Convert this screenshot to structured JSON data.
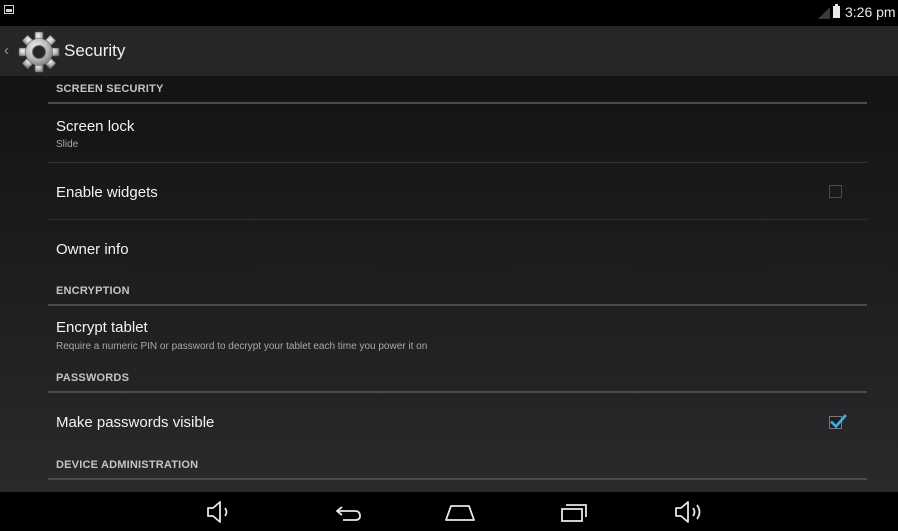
{
  "status_bar": {
    "time": "3:26 pm",
    "icons": [
      "notification-icon",
      "signal-icon",
      "battery-icon"
    ]
  },
  "action_bar": {
    "title": "Security",
    "icons": [
      "up-caret-icon",
      "settings-gear-icon"
    ]
  },
  "sections": {
    "screen_security": {
      "header": "SCREEN SECURITY",
      "screen_lock": {
        "title": "Screen lock",
        "summary": "Slide"
      },
      "enable_widgets": {
        "title": "Enable widgets",
        "checked": false
      },
      "owner_info": {
        "title": "Owner info"
      }
    },
    "encryption": {
      "header": "ENCRYPTION",
      "encrypt_tablet": {
        "title": "Encrypt tablet",
        "summary": "Require a numeric PIN or password to decrypt your tablet each time you power it on"
      }
    },
    "passwords": {
      "header": "PASSWORDS",
      "make_passwords_visible": {
        "title": "Make passwords visible",
        "checked": true
      }
    },
    "device_administration": {
      "header": "DEVICE ADMINISTRATION"
    }
  },
  "nav_bar": {
    "buttons": [
      "volume-down-icon",
      "back-icon",
      "home-icon",
      "recent-apps-icon",
      "volume-up-icon"
    ]
  },
  "colors": {
    "accent": "#33b5e5",
    "background": "#1a1a1b",
    "action_bar": "#262626",
    "divider": "#4b4b4b"
  }
}
